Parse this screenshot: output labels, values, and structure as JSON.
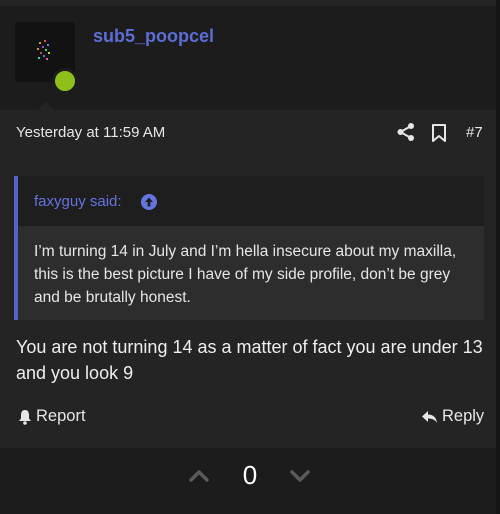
{
  "post": {
    "author": "sub5_poopcel",
    "status_color": "#8fbf1a",
    "timestamp": "Yesterday at 11:59 AM",
    "number": "#7",
    "icons": {
      "share": "share-icon",
      "bookmark": "bookmark-icon",
      "quote_jump": "arrow-up-circle-icon",
      "report": "bell-icon",
      "reply": "reply-arrow-icon",
      "vote_up": "chevron-up-icon",
      "vote_down": "chevron-down-icon"
    }
  },
  "quote": {
    "author": "faxyguy said:",
    "text": "I’m turning 14 in July and I’m hella insecure about my maxilla, this is the best picture I have of my side profile, don’t be grey and be brutally honest."
  },
  "reply": {
    "text": "You are not turning 14 as a matter of fact you are under 13 and you look 9"
  },
  "actions": {
    "report_label": "Report",
    "reply_label": "Reply"
  },
  "votes": {
    "score": "0"
  },
  "colors": {
    "link": "#5d6dd6",
    "quote_bar": "#5562c7",
    "background": "#242424"
  }
}
